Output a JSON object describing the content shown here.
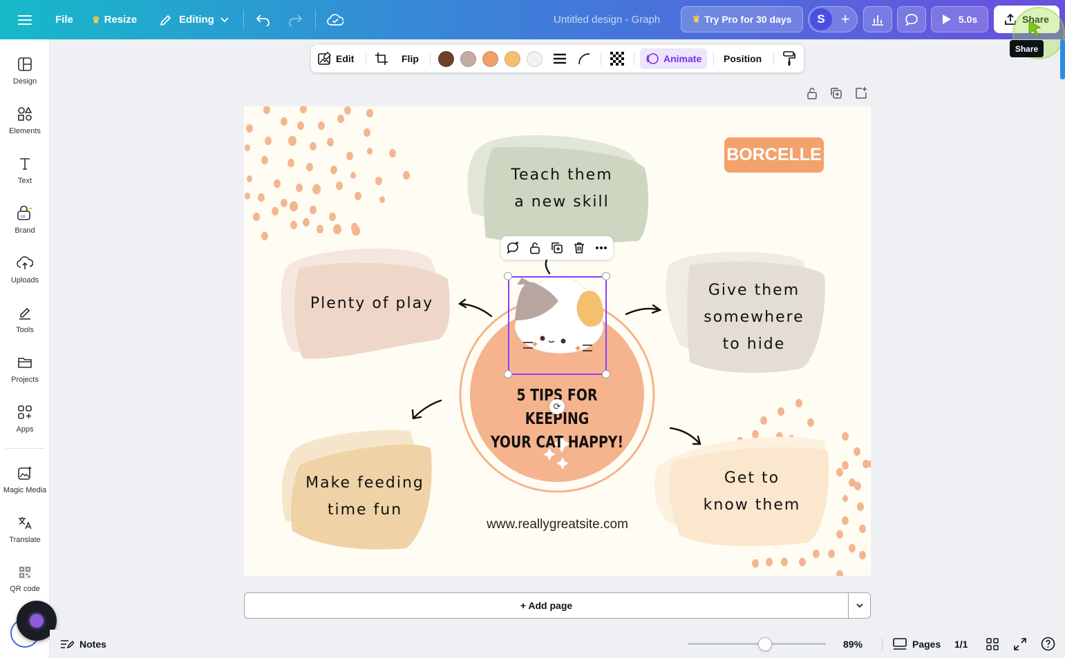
{
  "topbar": {
    "file": "File",
    "resize": "Resize",
    "editing": "Editing",
    "title": "Untitled design - Graph",
    "try_pro": "Try Pro for 30 days",
    "avatar_initial": "S",
    "play_time": "5.0s",
    "share": "Share"
  },
  "tooltip": "Share",
  "sidebar": {
    "items": [
      {
        "label": "Design",
        "icon": "layout-icon"
      },
      {
        "label": "Elements",
        "icon": "shapes-icon"
      },
      {
        "label": "Text",
        "icon": "text-icon"
      },
      {
        "label": "Brand",
        "icon": "brand-icon"
      },
      {
        "label": "Uploads",
        "icon": "cloud-upload-icon"
      },
      {
        "label": "Tools",
        "icon": "pen-icon"
      },
      {
        "label": "Projects",
        "icon": "folder-icon"
      },
      {
        "label": "Apps",
        "icon": "apps-icon"
      },
      {
        "label": "Magic Media",
        "icon": "magic-media-icon"
      },
      {
        "label": "Translate",
        "icon": "translate-icon"
      },
      {
        "label": "QR code",
        "icon": "qr-code-icon"
      }
    ]
  },
  "context_toolbar": {
    "edit": "Edit",
    "flip": "Flip",
    "animate": "Animate",
    "position": "Position",
    "colors": [
      "#6b4228",
      "#c4aca4",
      "#f0a06a",
      "#f5c06e",
      "#f2f2f2"
    ]
  },
  "design": {
    "brand": "BORCELLE",
    "tip_top": [
      "Teach them",
      "a new skill"
    ],
    "tip_left": "Plenty of play",
    "tip_right": [
      "Give them",
      "somewhere",
      "to hide"
    ],
    "tip_bottom_left": [
      "Make feeding",
      "time fun"
    ],
    "tip_bottom_right": [
      "Get to",
      "know them"
    ],
    "center_title": [
      "5 TIPS FOR KEEPING",
      "YOUR CAT HAPPY!"
    ],
    "website": "www.reallygreatsite.com",
    "palette": {
      "dots": "#f3b690",
      "green": "#cdd6c0",
      "green_back": "#e2e6d6",
      "pink": "#eed7c9",
      "pink_back": "#f5e7dd",
      "beige": "#e4ddd4",
      "beige_back": "#efebe5",
      "tan": "#efd3a6",
      "tan_back": "#f5e6cb",
      "cream": "#fbe7cd",
      "cream_back": "#fcf0df",
      "orange": "#f5b48d",
      "brand_bg": "#f3a26d"
    }
  },
  "add_page": "+ Add page",
  "bottombar": {
    "notes": "Notes",
    "zoom": "89%",
    "zoom_value": 0.56,
    "pages": "Pages",
    "page_count": "1/1"
  }
}
